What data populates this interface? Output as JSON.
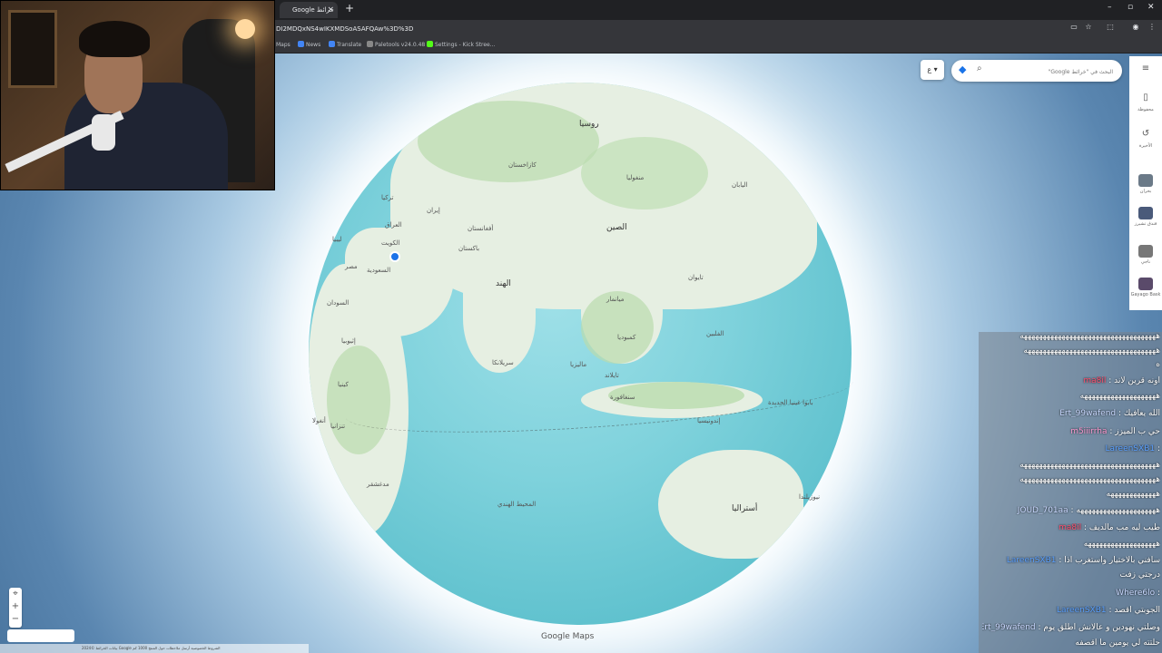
{
  "browser": {
    "tab_title": "Google خرائط",
    "tab_close": "×",
    "new_tab": "+",
    "url": "DI2MDQxNS4wIKXMDSoASAFQAw%3D%3D",
    "window_controls": [
      "–",
      "▫",
      "✕"
    ],
    "addr_icons": [
      "screen-icon",
      "star-icon",
      "extensions-icon",
      "profile-icon",
      "menu-icon"
    ],
    "bookmarks": [
      {
        "label": "Maps",
        "color": "#34a853"
      },
      {
        "label": "News",
        "color": "#4285f4"
      },
      {
        "label": "Translate",
        "color": "#4285f4"
      },
      {
        "label": "Paletools v24.0.48",
        "color": "#888888"
      },
      {
        "label": "Settings - Kick Stree...",
        "color": "#53fc18"
      }
    ]
  },
  "search": {
    "placeholder": "البحث في \"خرائط Google\""
  },
  "layer_button": "ع",
  "rail": {
    "items": [
      {
        "label": "محفوظة",
        "icon": "bookmark-icon"
      },
      {
        "label": "الأخيرة",
        "icon": "history-icon"
      },
      {
        "label": "بحران",
        "icon": "thumb"
      },
      {
        "label": "فندق تشيرز",
        "icon": "thumb"
      },
      {
        "label": "ناجي",
        "icon": "thumb"
      },
      {
        "label": "Gayago Bask",
        "icon": "thumb"
      }
    ]
  },
  "map": {
    "labels": [
      {
        "t": "روسيا",
        "big": true
      },
      {
        "t": "الصين",
        "big": true
      },
      {
        "t": "الهند",
        "big": true
      },
      {
        "t": "أستراليا",
        "big": true
      },
      {
        "t": "كازاخستان",
        "big": false
      },
      {
        "t": "منغوليا",
        "big": false
      },
      {
        "t": "أفغانستان",
        "big": false
      },
      {
        "t": "باكستان",
        "big": false
      },
      {
        "t": "إيران",
        "big": false
      },
      {
        "t": "العراق",
        "big": false
      },
      {
        "t": "تركيا",
        "big": false
      },
      {
        "t": "السعودية",
        "big": false
      },
      {
        "t": "ليبيا",
        "big": false
      },
      {
        "t": "مصر",
        "big": false
      },
      {
        "t": "السودان",
        "big": false
      },
      {
        "t": "إثيوبيا",
        "big": false
      },
      {
        "t": "كينيا",
        "big": false
      },
      {
        "t": "تنزانيا",
        "big": false
      },
      {
        "t": "أنغولا",
        "big": false
      },
      {
        "t": "مدغشقر",
        "big": false
      },
      {
        "t": "ميانمار",
        "big": false
      },
      {
        "t": "تايلاند",
        "big": false
      },
      {
        "t": "سنغافورة",
        "big": false
      },
      {
        "t": "إندونيسيا",
        "big": false
      },
      {
        "t": "الفلبين",
        "big": false
      },
      {
        "t": "اليابان",
        "big": false
      },
      {
        "t": "تايوان",
        "big": false
      },
      {
        "t": "بابوا غينيا الجديدة",
        "big": false
      },
      {
        "t": "سريلانكا",
        "big": false
      },
      {
        "t": "ماليزيا",
        "big": false
      },
      {
        "t": "كمبوديا",
        "big": false
      },
      {
        "t": "الكويت",
        "big": false
      },
      {
        "t": "المحيط الهندي",
        "big": false
      },
      {
        "t": "نيوزيلندا",
        "big": false
      }
    ]
  },
  "chat": {
    "lines": [
      {
        "user": "",
        "msg": "ههههههههههههههههههههههههههههههههههههه",
        "cls": ""
      },
      {
        "user": "",
        "msg": "هههههههههههههههههههههههههههههههههههه",
        "cls": ""
      },
      {
        "user": "",
        "msg": "ه",
        "cls": ""
      },
      {
        "user": "ma8il",
        "msg": "اونه قرين لاند",
        "cls": "red"
      },
      {
        "user": "",
        "msg": "ههههههههههههههههههههه",
        "cls": ""
      },
      {
        "user": "Ert_99wafend",
        "msg": "الله يعافيك",
        "cls": ""
      },
      {
        "user": "m5iiirrha",
        "msg": "حي ب الميزز",
        "cls": "pink"
      },
      {
        "user": "LareenSXB1",
        "msg": "",
        "cls": "blue"
      },
      {
        "user": "",
        "msg": "ههههههههههههههههههههههههههههههههههههه",
        "cls": ""
      },
      {
        "user": "",
        "msg": "ههههههههههههههههههههههههههههههههههههه",
        "cls": ""
      },
      {
        "user": "",
        "msg": "هههههههههههههه",
        "cls": ""
      },
      {
        "user": "JOUD_701aa",
        "msg": "هههههههههههههههههههههه",
        "cls": ""
      },
      {
        "user": "ma8il",
        "msg": "طيب ليه مب مالديف",
        "cls": "red"
      },
      {
        "user": "",
        "msg": "هههههههههههههههههههه",
        "cls": ""
      },
      {
        "user": "LareenSXB1",
        "msg": "سافني بالاختيار واستغرب اذا",
        "cls": "blue"
      },
      {
        "user": "",
        "msg": "درجتي زفت",
        "cls": ""
      },
      {
        "user": "Where6lo",
        "msg": "",
        "cls": ""
      },
      {
        "user": "LareenSXB1",
        "msg": "الجوبتي اقصد",
        "cls": "blue"
      },
      {
        "user": "Ert_99wafend",
        "msg": "وصلتي نهودين و عالانش اطلق يوم",
        "cls": ""
      },
      {
        "user": "",
        "msg": "حلتته لي يومين ما أقصفه",
        "cls": ""
      }
    ]
  },
  "controls": {
    "zoom_in": "+",
    "zoom_out": "−",
    "locate": "⌖",
    "logo": "Google Maps",
    "footer": "بيانات الخرائط ©2024 Google الشروط الخصوصية أرسل ملاحظات حول المنتج 1000 كم"
  }
}
